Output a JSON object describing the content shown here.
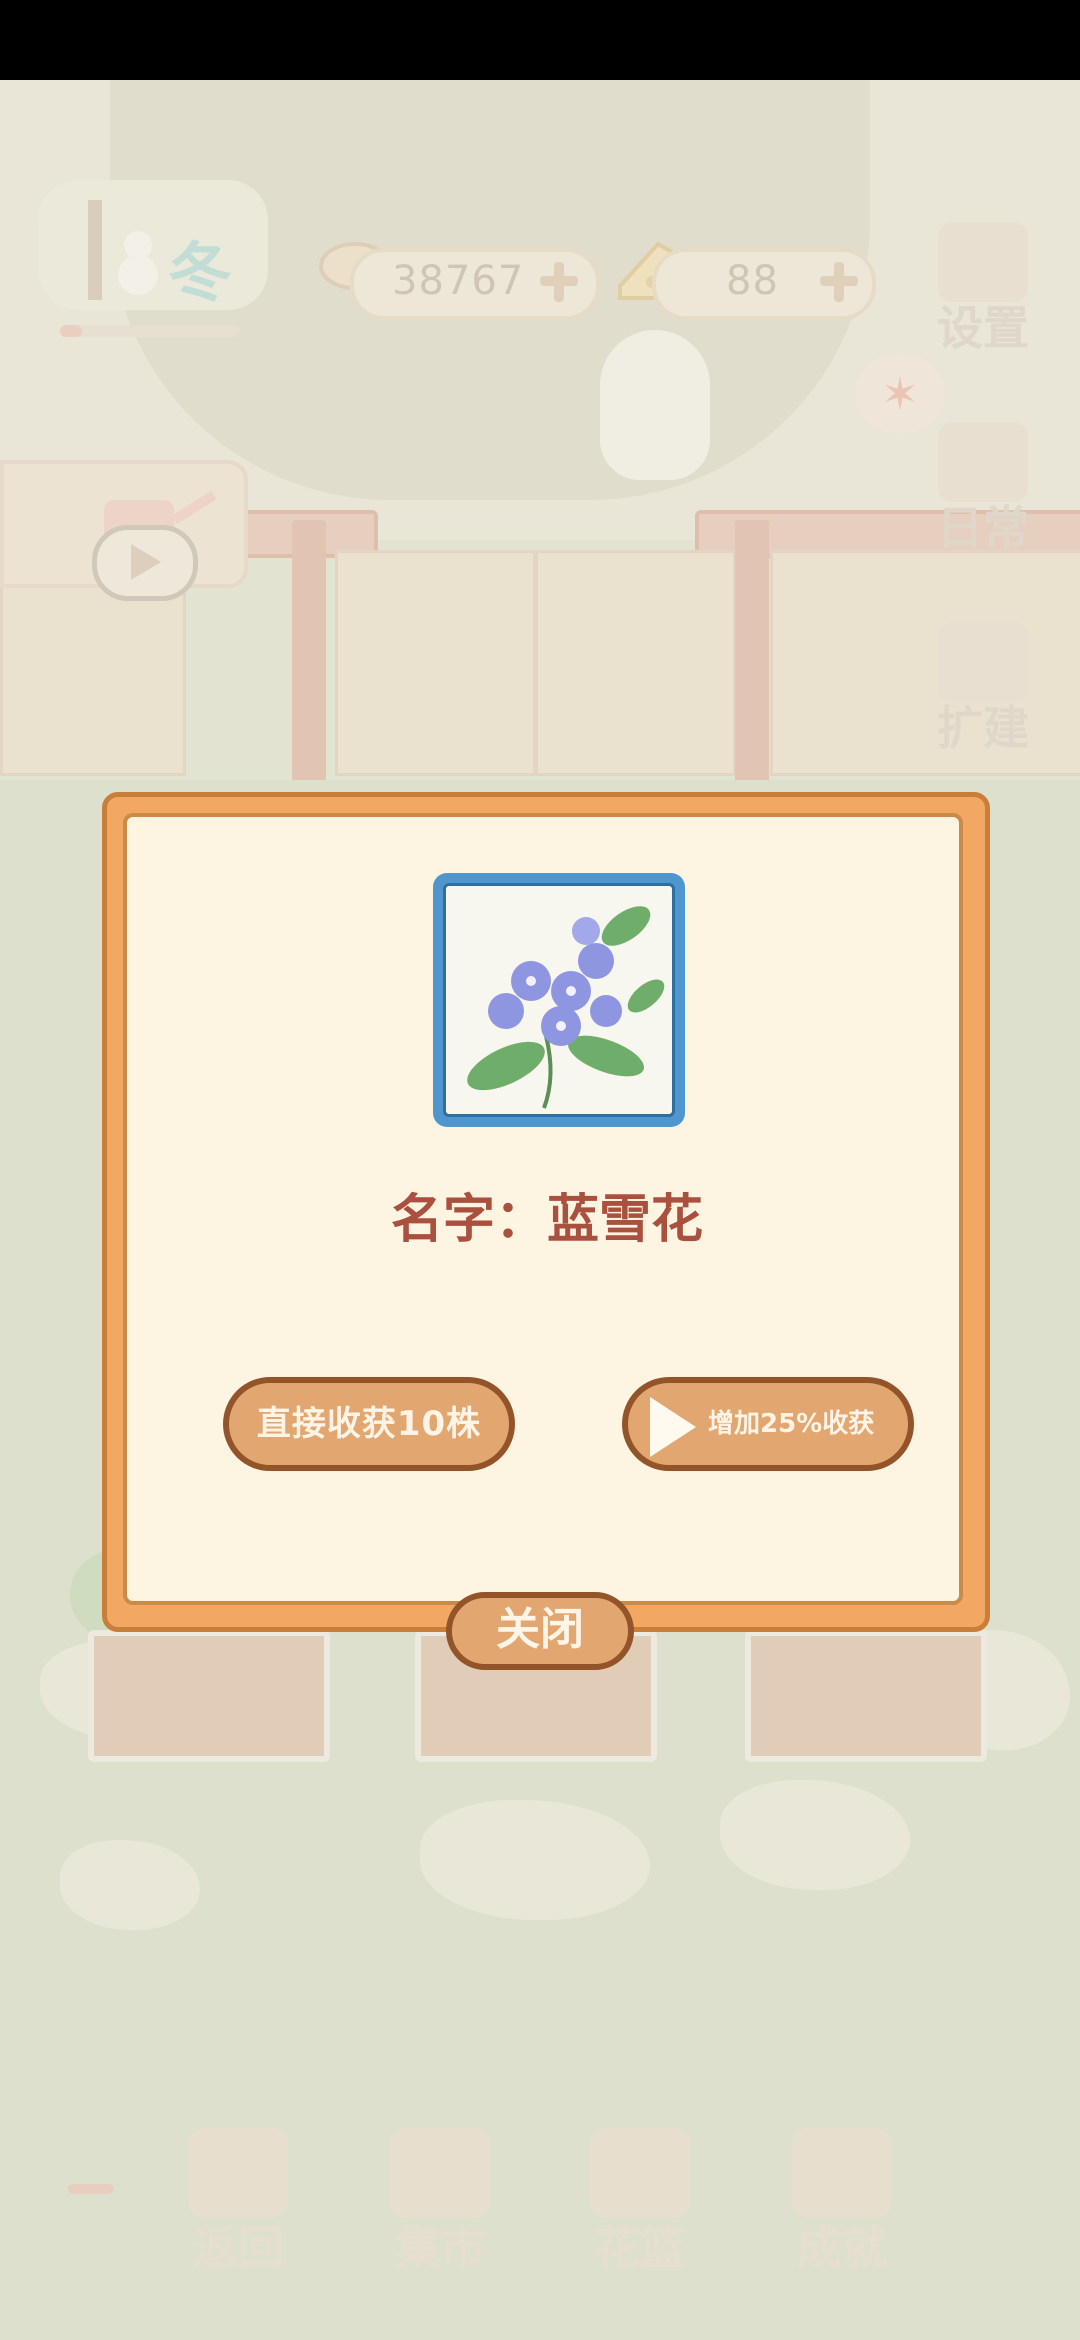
{
  "hud": {
    "season": "冬",
    "fish_count": "38767",
    "cheese_count": "88"
  },
  "side_menu": {
    "settings": "设置",
    "daily": "日常",
    "expand": "扩建"
  },
  "dialog": {
    "flower_name": "名字：蓝雪花",
    "harvest_button": "直接收获10株",
    "boost_button": "增加25%收获",
    "close_button": "关闭"
  },
  "bottom_nav": {
    "back": "返回",
    "market": "集市",
    "basket": "花篮",
    "achievement": "成就"
  },
  "colors": {
    "dialog_frame": "#f2a863",
    "dialog_bg": "#fdf5e2",
    "button_fill": "#e2a771",
    "button_border": "#93542a",
    "title_text": "#a9503e",
    "flower_frame": "#4f96cf"
  }
}
